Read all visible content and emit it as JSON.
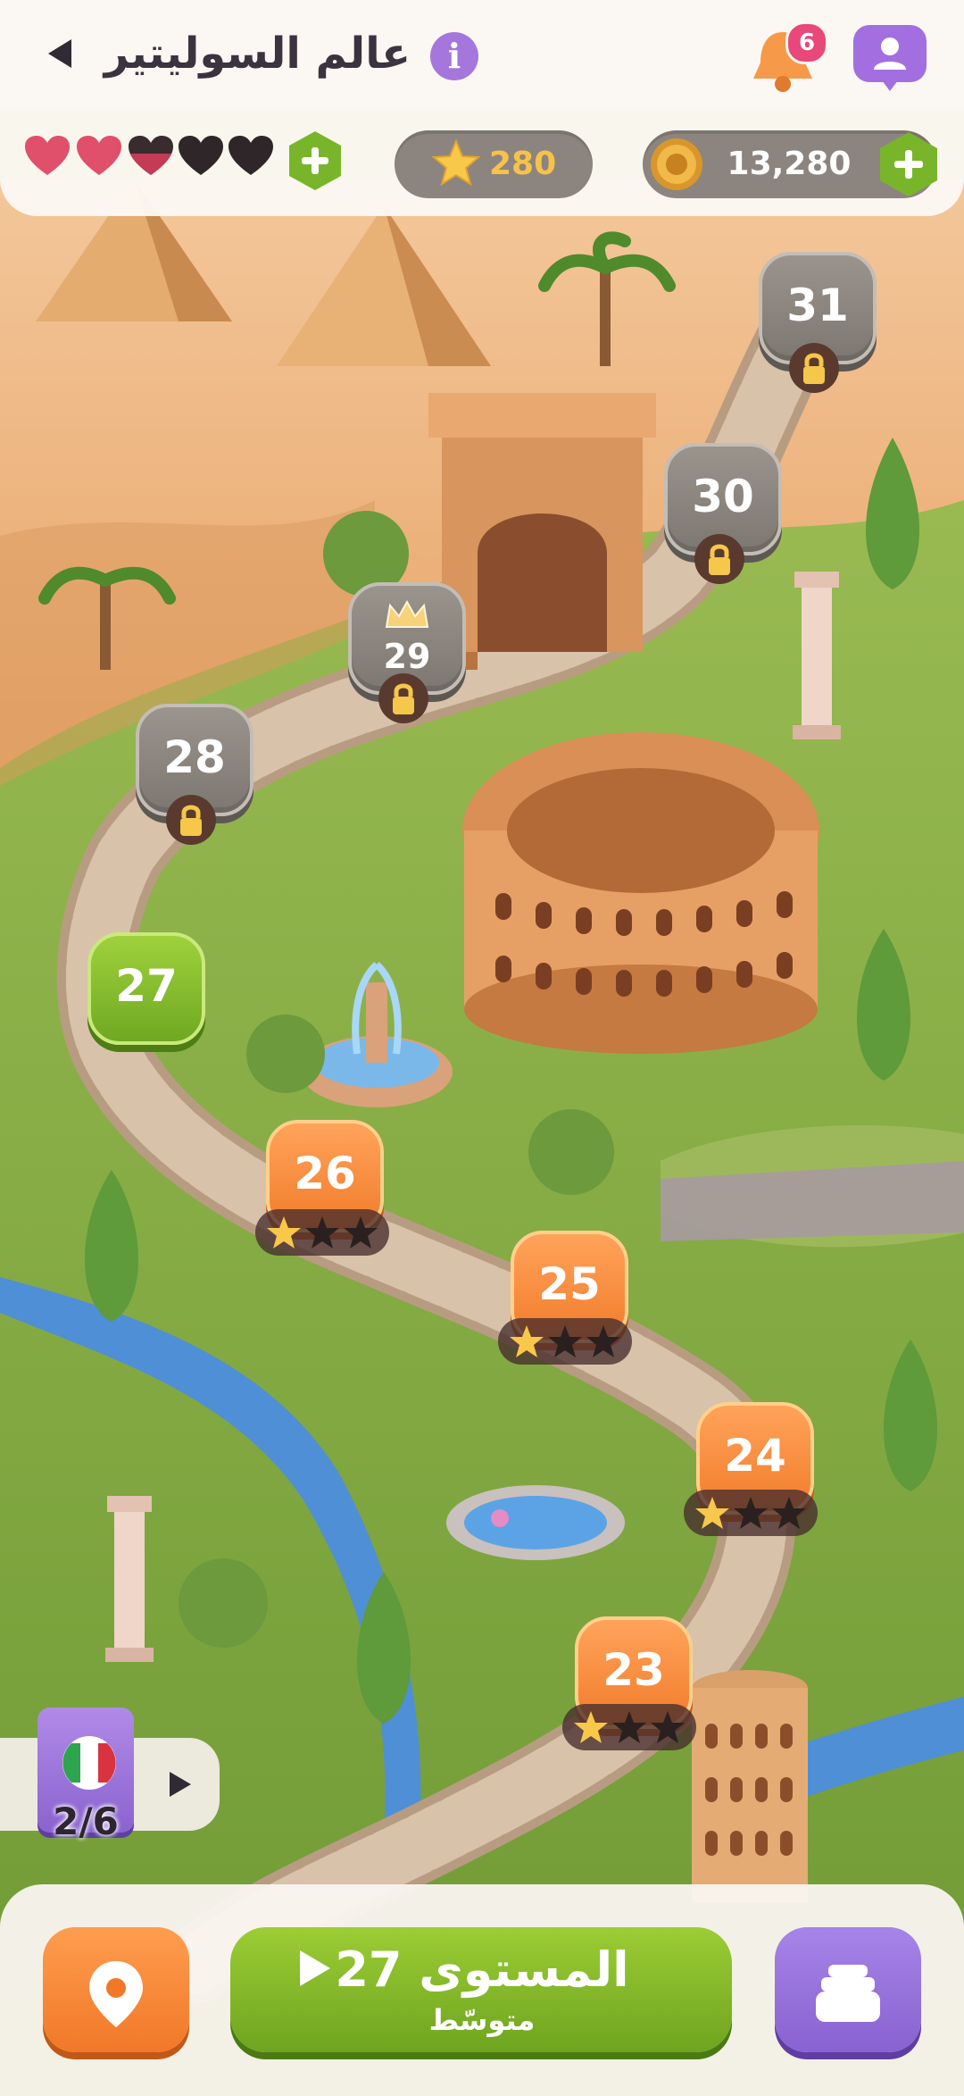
{
  "header": {
    "title": "عالم السوليتير",
    "info_label": "i",
    "notifications_count": "6"
  },
  "resources": {
    "hearts": [
      {
        "state": "full"
      },
      {
        "state": "full"
      },
      {
        "state": "partial"
      },
      {
        "state": "empty"
      },
      {
        "state": "empty"
      }
    ],
    "stars": "280",
    "coins": "13,280"
  },
  "levels": [
    {
      "number": "31",
      "state": "locked"
    },
    {
      "number": "30",
      "state": "locked"
    },
    {
      "number": "29",
      "state": "locked",
      "badge": "crown"
    },
    {
      "number": "28",
      "state": "locked"
    },
    {
      "number": "27",
      "state": "current"
    },
    {
      "number": "26",
      "state": "completed",
      "stars_earned": 1,
      "stars_total": 3
    },
    {
      "number": "25",
      "state": "completed",
      "stars_earned": 1,
      "stars_total": 3
    },
    {
      "number": "24",
      "state": "completed",
      "stars_earned": 1,
      "stars_total": 3
    },
    {
      "number": "23",
      "state": "completed",
      "stars_earned": 1,
      "stars_total": 3
    }
  ],
  "collection": {
    "progress": "2/6",
    "flag": "italy"
  },
  "bottom_bar": {
    "play_label": "المستوى 27",
    "difficulty": "متوسّط"
  },
  "colors": {
    "accent_orange": "#f27c2b",
    "accent_green": "#6fa822",
    "accent_purple": "#8862d1",
    "heart_red": "#e0506a",
    "star_gold": "#f7c24a"
  },
  "icons": {
    "back": "back-arrow-icon",
    "info": "info-icon",
    "bell": "bell-icon",
    "profile": "profile-icon",
    "coin": "coin-icon",
    "star": "star-icon",
    "lock": "lock-icon",
    "crown": "crown-icon",
    "map": "map-pin-icon",
    "stack": "card-stack-icon"
  }
}
